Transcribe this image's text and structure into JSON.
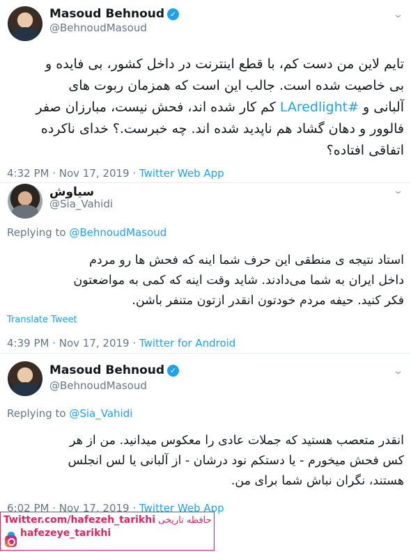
{
  "tweets": [
    {
      "name": "Masoud Behnoud",
      "verified": true,
      "handle": "@BehnoudMasoud",
      "lines": [
        "تایم لاین من دست کم، با قطع اینترنت در داخل کشور، بی فایده و",
        "بی خاصیت شده است. جالب این است که همزمان ربوت های",
        "آلبانی و #LAredlight کم کار شده اند، فحش نیست، مبارزان صفر",
        "فالوور و دهان گشاد هم ناپدید شده اند. چه خبرست.؟ خدای ناکرده",
        "اتفاقی افتاده؟"
      ],
      "hashtag": "#LAredlight",
      "line3_before": "آلبانی و ",
      "line3_after": " کم کار شده اند، فحش نیست، مبارزان صفر",
      "time": "4:32 PM · Nov 17, 2019 · ",
      "app": "Twitter Web App"
    },
    {
      "name": "سیاوش",
      "handle": "@Sia_Vahidi",
      "replying_label": "Replying to ",
      "replying_to": "@BehnoudMasoud",
      "lines": [
        "استاد نتیجه ی منطقی این حرف شما اینه که فحش ها رو مردم",
        "داخل ایران به شما می‌دادند. شاید وقت اینه که کمی به مواضعتون",
        "فکر کنید. حیفه مردم خودتون انقدر ازتون متنفر باشن."
      ],
      "translate": "Translate Tweet",
      "time": "4:39 PM · Nov 17, 2019 · ",
      "app": "Twitter for Android"
    },
    {
      "name": "Masoud Behnoud",
      "verified": true,
      "handle": "@BehnoudMasoud",
      "replying_label": "Replying to ",
      "replying_to": "@Sia_Vahidi",
      "lines": [
        "انقدر متعصب هستید که جملات عادی را معکوس میدانید. من از هر",
        "کس فحش میخورم - یا دستکم نود درشان - از آلبانی یا لس انجلس",
        "هستند، نگران نباش شما برای من."
      ],
      "time": "6:02 PM · Nov 17, 2019 · ",
      "app": "Twitter Web App"
    }
  ],
  "watermark": {
    "site": "Twitter.com/hafezeh_tarikhi",
    "site_fa": "حافظه تاریخی",
    "instagram": "hafezeye_tarikhi"
  },
  "colors": {
    "link": "#1da1f2",
    "muted": "#657786",
    "watermark": "#e0245e"
  }
}
